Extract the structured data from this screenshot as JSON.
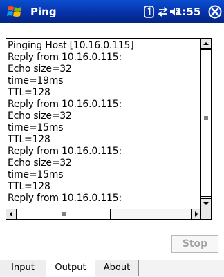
{
  "window": {
    "title": "Ping",
    "status_icons": [
      "sim-one-icon",
      "connectivity-icon",
      "speaker-muted-icon"
    ],
    "clock": "1:55",
    "close_icon": "close-icon",
    "accent_color": "#0a4fd0"
  },
  "output": {
    "lines": [
      "Pinging Host [10.16.0.115]",
      "Reply from 10.16.0.115:",
      "Echo size=32",
      "time=19ms",
      "TTL=128",
      "Reply from 10.16.0.115:",
      "Echo size=32",
      "time=15ms",
      "TTL=128",
      "Reply from 10.16.0.115:",
      "Echo size=32",
      "time=15ms",
      "TTL=128",
      "Reply from 10.16.0.115:"
    ]
  },
  "stop_button": {
    "label": "Stop",
    "enabled": false
  },
  "tabs": [
    {
      "label": "Input"
    },
    {
      "label": "Output",
      "active": true
    },
    {
      "label": "About"
    }
  ]
}
